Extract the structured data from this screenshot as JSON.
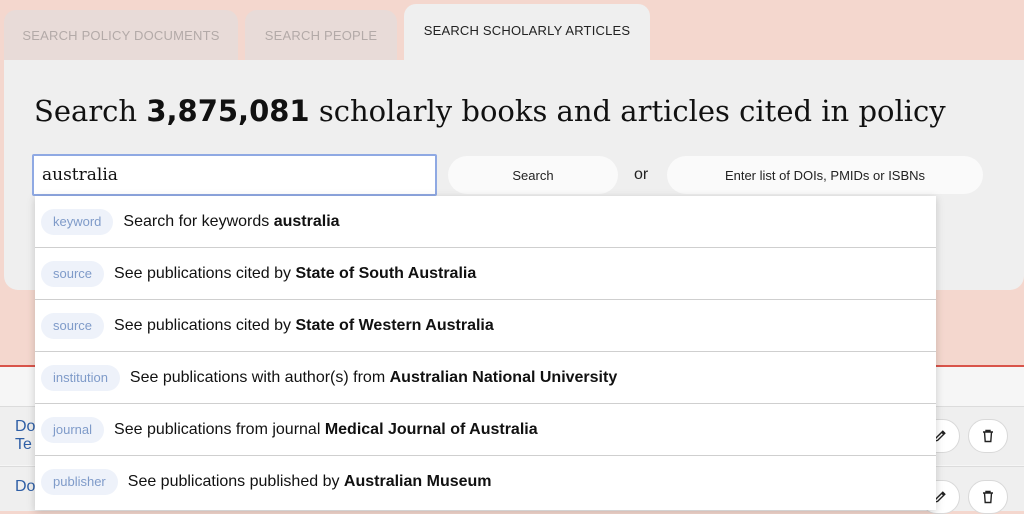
{
  "tabs": [
    {
      "label": "SEARCH POLICY DOCUMENTS",
      "active": false
    },
    {
      "label": "SEARCH PEOPLE",
      "active": false
    },
    {
      "label": "SEARCH SCHOLARLY ARTICLES",
      "active": true
    }
  ],
  "headline": {
    "prefix": "Search",
    "count": "3,875,081",
    "suffix": "scholarly books and articles cited in policy"
  },
  "search": {
    "value": "australia",
    "button_label": "Search",
    "or_label": "or",
    "dois_button_label": "Enter list of DOIs, PMIDs or ISBNs"
  },
  "suggestions": [
    {
      "badge": "keyword",
      "text": "Search for keywords",
      "target": "australia"
    },
    {
      "badge": "source",
      "text": "See publications cited by",
      "target": "State of South Australia"
    },
    {
      "badge": "source",
      "text": "See publications cited by",
      "target": "State of Western Australia"
    },
    {
      "badge": "institution",
      "text": "See publications with author(s) from",
      "target": "Australian National University"
    },
    {
      "badge": "journal",
      "text": "See publications from journal",
      "target": "Medical Journal of Australia"
    },
    {
      "badge": "publisher",
      "text": "See publications published by",
      "target": "Australian Museum"
    }
  ],
  "background_rows": [
    {
      "fragment_1": "Do",
      "fragment_2": "Te"
    },
    {
      "fragment_1": "Do",
      "fragment_2": ""
    }
  ],
  "icons": {
    "edit": "pencil-icon",
    "delete": "trash-icon"
  },
  "colors": {
    "page_bg": "#f4d7ce",
    "panel_bg": "#efefef",
    "input_border": "#8fa9e3",
    "badge_text": "#7f9bc9",
    "accent_rule": "#d9544a"
  }
}
